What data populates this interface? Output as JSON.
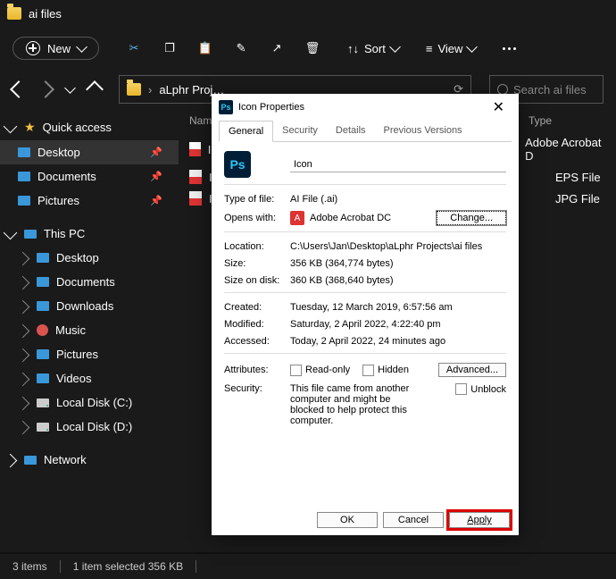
{
  "title": "ai files",
  "toolbar": {
    "new": "New",
    "sort": "Sort",
    "view": "View"
  },
  "breadcrumb": "aLphr Proj…",
  "search_placeholder": "Search ai files",
  "sidebar": {
    "quick": "Quick access",
    "items_quick": [
      "Desktop",
      "Documents",
      "Pictures"
    ],
    "thispc": "This PC",
    "items_pc": [
      "Desktop",
      "Documents",
      "Downloads",
      "Music",
      "Pictures",
      "Videos",
      "Local Disk (C:)",
      "Local Disk (D:)"
    ],
    "network": "Network"
  },
  "list": {
    "head_name": "Name",
    "head_type": "Type",
    "rows": [
      {
        "name": "Ic",
        "type": "Adobe Acrobat D"
      },
      {
        "name": "Ic",
        "type": "EPS File"
      },
      {
        "name": "Ic",
        "type": "JPG File"
      }
    ]
  },
  "dialog": {
    "title": "Icon Properties",
    "tabs": [
      "General",
      "Security",
      "Details",
      "Previous Versions"
    ],
    "filename": "Icon",
    "typeof_lbl": "Type of file:",
    "typeof": "AI File (.ai)",
    "opens_lbl": "Opens with:",
    "opens": "Adobe Acrobat DC",
    "change": "Change...",
    "location_lbl": "Location:",
    "location": "C:\\Users\\Jan\\Desktop\\aLphr Projects\\ai files",
    "size_lbl": "Size:",
    "size": "356 KB (364,774 bytes)",
    "sizedisk_lbl": "Size on disk:",
    "sizedisk": "360 KB (368,640 bytes)",
    "created_lbl": "Created:",
    "created": "Tuesday, 12 March 2019, 6:57:56 am",
    "modified_lbl": "Modified:",
    "modified": "Saturday, 2 April 2022, 4:22:40 pm",
    "accessed_lbl": "Accessed:",
    "accessed": "Today, 2 April 2022, 24 minutes ago",
    "attr_lbl": "Attributes:",
    "readonly": "Read-only",
    "hidden": "Hidden",
    "advanced": "Advanced...",
    "security_lbl": "Security:",
    "security_txt": "This file came from another computer and might be blocked to help protect this computer.",
    "unblock": "Unblock",
    "ok": "OK",
    "cancel": "Cancel",
    "apply": "Apply"
  },
  "status": {
    "items": "3 items",
    "selected": "1 item selected  356 KB"
  }
}
